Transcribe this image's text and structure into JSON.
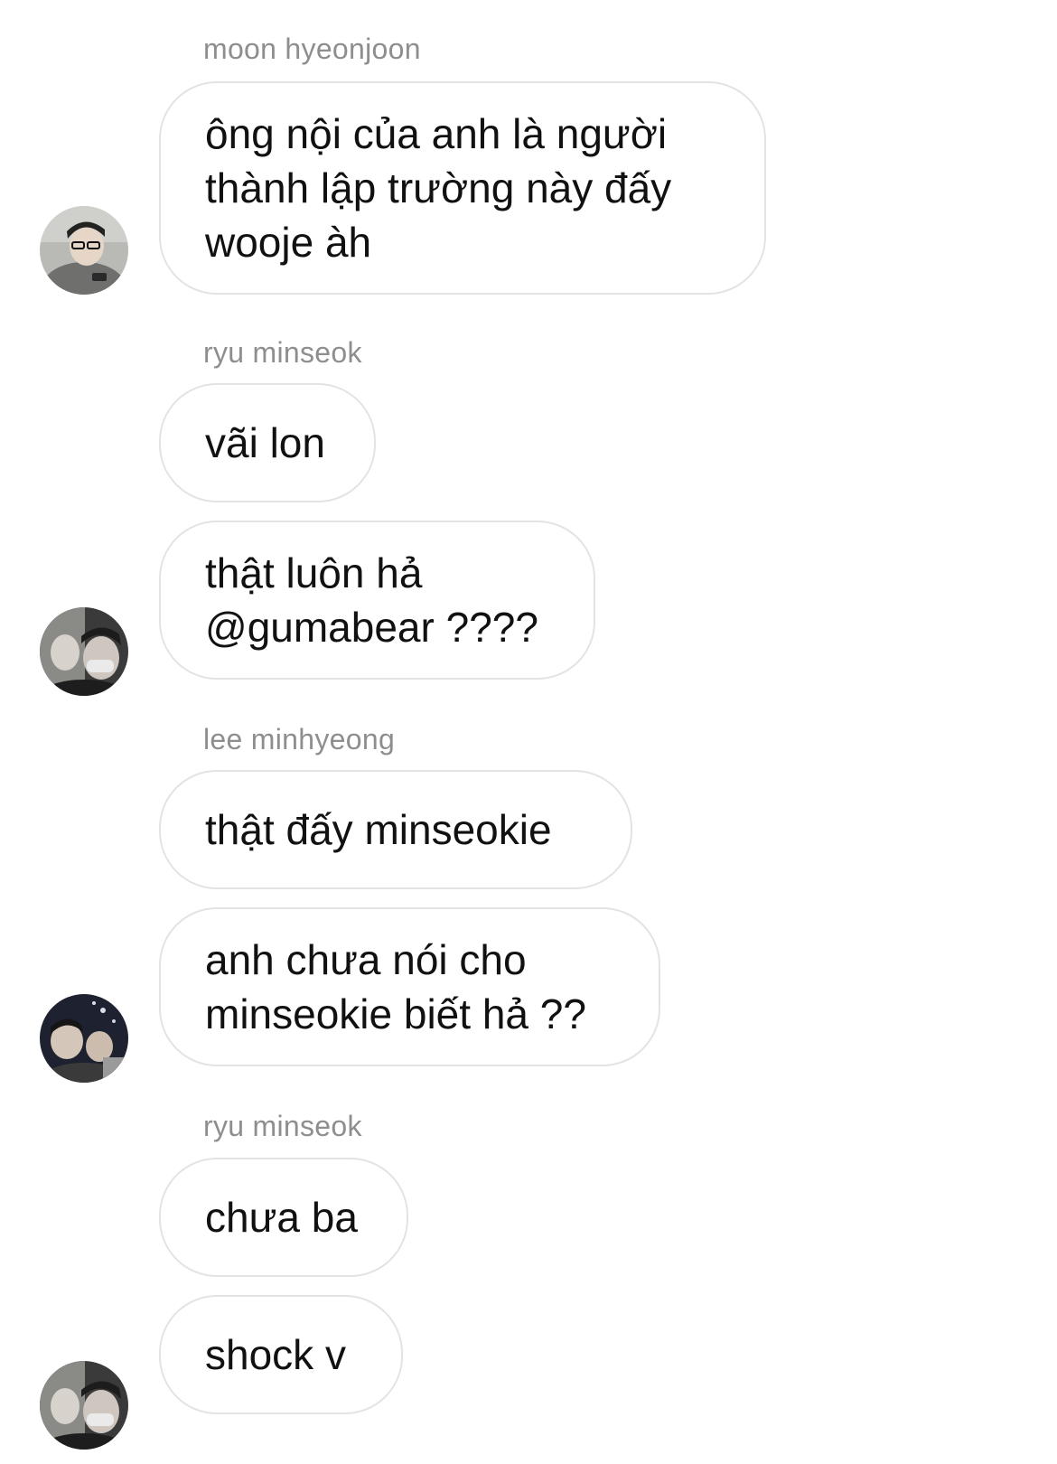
{
  "messages": [
    {
      "sender": "moon hyeonjoon",
      "text": "ông nội của anh là người\nthành lập trường này đấy\nwooje àh"
    },
    {
      "sender": "ryu minseok",
      "text": "vãi lon"
    },
    {
      "text": "thật luôn hả\n@gumabear ????"
    },
    {
      "sender": "lee minhyeong",
      "text": "thật đấy minseokie"
    },
    {
      "text": "anh chưa nói cho\nminseokie biết hả ??"
    },
    {
      "sender": "ryu minseok",
      "text": "chưa ba"
    },
    {
      "text": "shock v"
    }
  ],
  "avatars": [
    {
      "icon": "avatar-moon-hyeonjoon"
    },
    {
      "icon": "avatar-ryu-minseok"
    },
    {
      "icon": "avatar-lee-minhyeong"
    },
    {
      "icon": "avatar-ryu-minseok"
    }
  ],
  "colors": {
    "bubble_border": "#e3e3e3",
    "sender_text": "#8e8e8e",
    "message_text": "#111111",
    "background": "#ffffff"
  }
}
